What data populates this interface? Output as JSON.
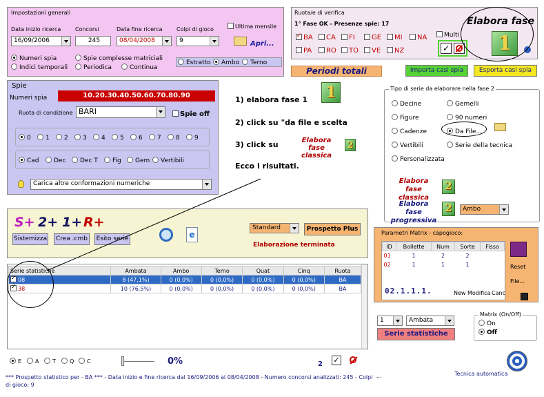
{
  "impostazioni": {
    "title": "Impostazioni generali",
    "data_inizio_label": "Data inizio ricerca",
    "data_inizio_value": "16/09/2006",
    "concorsi_label": "Concorsi",
    "concorsi_value": "245",
    "data_fine_label": "Data fine ricerca",
    "data_fine_value": "08/04/2008",
    "colpi_label": "Colpi di gioco",
    "colpi_value": "9",
    "ultima_mensile_label": "Ultima mensile",
    "apri_label": "Apri...",
    "radio_numeri_spia": "Numeri spia",
    "radio_indici_temporali": "Indici temporali",
    "radio_spie_complesse": "Spie complesse matriciali",
    "radio_periodica": "Periodica",
    "radio_continua": "Continua",
    "radio_estratto": "Estratto",
    "radio_ambo": "Ambo",
    "radio_terno": "Terno"
  },
  "spie": {
    "title": "Spie",
    "numeri_spia_label": "Numeri spia",
    "numeri_spia_value": "10.20.30.40.50.60.70.80.90",
    "ruota_label": "Ruota di condizione",
    "ruota_value": "BARI",
    "spie_off_label": "Spie off",
    "digits": [
      "0",
      "1",
      "2",
      "3",
      "4",
      "5",
      "6",
      "7",
      "8",
      "9"
    ],
    "tipi": [
      "Cad",
      "Dec",
      "Dec T",
      "Fig",
      "Gem",
      "Vertibili"
    ],
    "carica_label": "Carica altre conformazioni numeriche"
  },
  "ruote": {
    "title": "Ruota/e di verifica",
    "status": "1° Fase OK - Presenze spie: 17",
    "row1": [
      "BA",
      "CA",
      "FI",
      "GE",
      "MI",
      "NA"
    ],
    "row2": [
      "PA",
      "RO",
      "TO",
      "VE",
      "NZ"
    ],
    "multi_label": "Multi",
    "elabora_fase_label": "Elabora fase",
    "elabora_fase_number": "1"
  },
  "buttons": {
    "periodi_totali": "Periodi totali",
    "importa_casi_spia": "Importa casi spia",
    "esporta_casi_spia": "Esporta casi spia"
  },
  "istruzioni": {
    "step1": "1) elabora fase 1",
    "step1_number": "1",
    "step2": "2) click su \"da file e scelta",
    "step3": "3) click su",
    "step3_button": "Elabora fase classica",
    "step3_number": "2",
    "risultati": "Ecco i risultati."
  },
  "tipo_serie": {
    "title": "Tipo di serie da elaborare nella fase 2",
    "left": [
      "Decine",
      "Figure",
      "Cadenze",
      "Vertibili",
      "Personalizzata"
    ],
    "right": [
      "Gemelli",
      "90 numeri",
      "Da File...",
      "Serie della tecnica"
    ],
    "elabora_classica": "Elabora fase classica",
    "elabora_classica_number": "2",
    "elabora_progressiva": "Elabora fase progressiva",
    "elabora_progressiva_number": "2",
    "sorte_value": "Ambo"
  },
  "toolbar": {
    "s_plus": "S+",
    "two_plus": "2+",
    "one_plus": "1+",
    "r_plus": "R+",
    "sistemizza": "Sistemizza",
    "crea_cmb": "Crea .cmb",
    "esito_serie": "Esito serie",
    "standard_value": "Standard",
    "prospetto_plus": "Prospetto Plus",
    "elaborazione_terminata": "Elaborazione terminata"
  },
  "matrix": {
    "title": "Parametri Matrix - capogioco:",
    "headers": [
      "ID",
      "Bollette",
      "Num",
      "Sorte",
      "Fisso"
    ],
    "rows": [
      [
        "01",
        "1",
        "2",
        "2",
        ""
      ],
      [
        "02",
        "1",
        "1",
        "1",
        ""
      ]
    ],
    "code": "02.1.1.1.",
    "new": "New",
    "modifica": "Modifica",
    "canc": "Canc",
    "reset": "Reset",
    "file": "File..."
  },
  "table": {
    "headers": [
      "Serie statistiche",
      "Ambata",
      "Ambo",
      "Terno",
      "Quat",
      "Cinq",
      "Ruota"
    ],
    "rows": [
      [
        "08",
        "8 (47,1%)",
        "0 (0,0%)",
        "0 (0,0%)",
        "0 (0,0%)",
        "0 (0,0%)",
        "BA"
      ],
      [
        "38",
        "10 (76,5%)",
        "0 (0,0%)",
        "0 (0,0%)",
        "0 (0,0%)",
        "0 (0,0%)",
        "BA"
      ]
    ]
  },
  "lower_right": {
    "combo_num": "1",
    "combo_sorte": "Ambata",
    "serie_statistiche_btn": "Serie statistiche",
    "matrix_onoff_title": "Matrix (On/Off)",
    "on": "On",
    "off": "Off",
    "tecnica_automatica": "Tecnica automatica"
  },
  "bottom": {
    "radios": [
      "E",
      "A",
      "T",
      "Q",
      "C"
    ],
    "progress_percent": "0%",
    "progress_fraction": 0,
    "count": "2",
    "status": "*** Prospetto statistico per  - BA ***  - Data inizio e fine ricerca dal 16/09/2006 al 08/04/2008 - Numero concorsi analizzati: 245 - Colpi di gioco: 9",
    "dots": "..."
  },
  "colors": {
    "impostazioni_bg": "#f2c6f0",
    "spie_bg": "#c9c6f2",
    "ruote_bg": "#f3e8f1",
    "table_selected": "#2f6bc5",
    "red_field": "#c80000",
    "orange_btn": "#f6b472",
    "green_btn": "#55d234",
    "yellow_btn": "#f2e820",
    "salmon_btn": "#f08080"
  }
}
